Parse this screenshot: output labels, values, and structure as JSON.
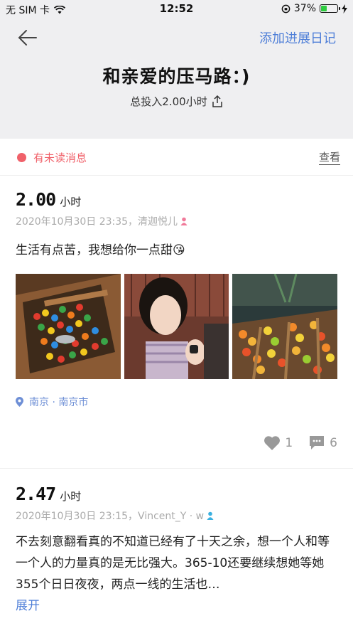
{
  "status_bar": {
    "carrier": "无 SIM 卡",
    "time": "12:52",
    "battery": "37%"
  },
  "header": {
    "add_diary": "添加进展日记",
    "title": "和亲爱的压马路：)",
    "total_hours": "总投入2.00小时"
  },
  "unread": {
    "text": "有未读消息",
    "view": "查看"
  },
  "posts": [
    {
      "hours": "2.00",
      "unit": "小时",
      "meta": "2020年10月30日 23:35，清迦悦儿",
      "content": "生活有点苦，我想给你一点甜😘",
      "location": "南京 · 南京市",
      "likes": "1",
      "comments": "6"
    },
    {
      "hours": "2.47",
      "unit": "小时",
      "meta": "2020年10月30日 23:15，Vincent_Y · w",
      "content": "不去刻意翻看真的不知道已经有了十天之余，想一个人和等一个人的力量真的是无比强大。365-10还要继续想她等她355个日日夜夜，两点一线的生活也…",
      "expand": "展开"
    }
  ]
}
